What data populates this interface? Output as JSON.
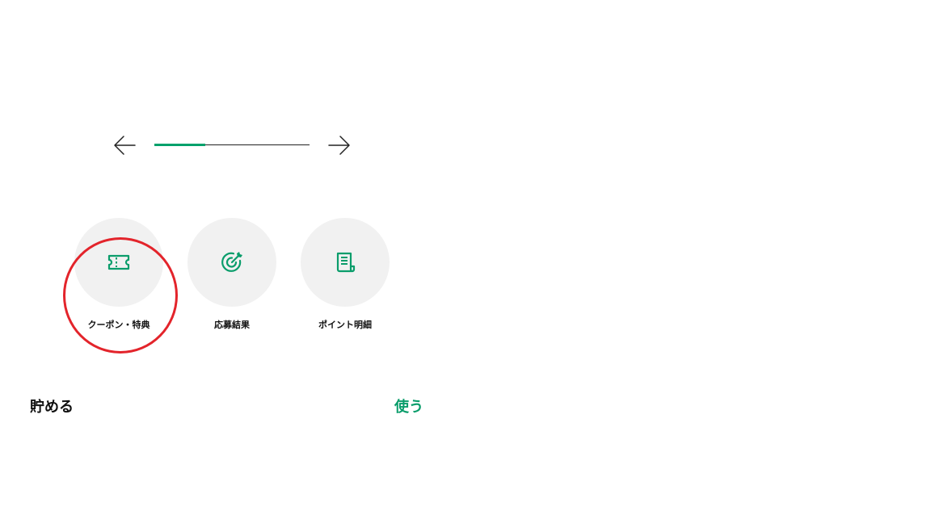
{
  "colors": {
    "accent": "#00a16b",
    "icon_green": "#0a9d6b",
    "circle_bg": "#f1f1f1",
    "highlight": "#e3242b"
  },
  "carousel": {
    "prev_icon": "arrow-left-icon",
    "next_icon": "arrow-right-icon",
    "progress_fraction": 0.33
  },
  "menu": {
    "items": [
      {
        "label": "クーポン・特典",
        "icon": "ticket-icon"
      },
      {
        "label": "応募結果",
        "icon": "target-icon"
      },
      {
        "label": "ポイント明細",
        "icon": "receipt-icon"
      }
    ]
  },
  "sections": {
    "save_title": "貯める",
    "use_title": "使う"
  }
}
